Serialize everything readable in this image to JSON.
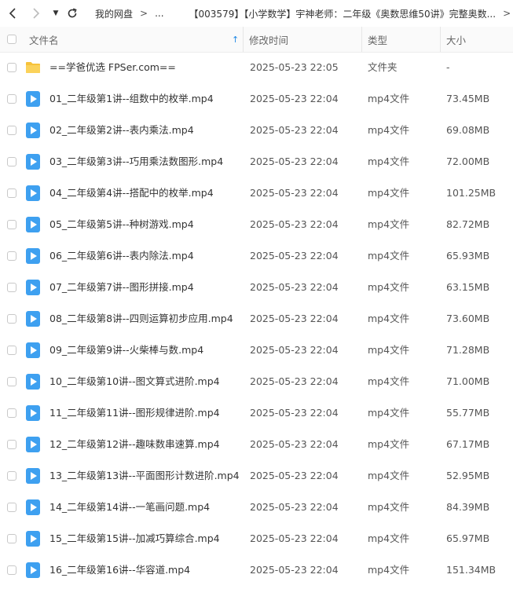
{
  "breadcrumb": {
    "home": "我的网盘",
    "ellipsis": "...",
    "current": "【003579】【小学数学】宇神老师：二年级《奥数思维50讲》完整奥数...",
    "separator": ">"
  },
  "columns": {
    "name": "文件名",
    "modified": "修改时间",
    "type": "类型",
    "size": "大小"
  },
  "icons": {
    "folder": "folder-icon",
    "video": "video-file-icon"
  },
  "colors": {
    "accent": "#1e88e5",
    "folder": "#f7c23a",
    "video": "#3ea0f0"
  },
  "files": [
    {
      "name": "==学爸优选 FPSer.com==",
      "modified": "2025-05-23 22:05",
      "type": "文件夹",
      "size": "-",
      "kind": "folder"
    },
    {
      "name": "01_二年级第1讲--组数中的枚举.mp4",
      "modified": "2025-05-23 22:04",
      "type": "mp4文件",
      "size": "73.45MB",
      "kind": "video"
    },
    {
      "name": "02_二年级第2讲--表内乘法.mp4",
      "modified": "2025-05-23 22:04",
      "type": "mp4文件",
      "size": "69.08MB",
      "kind": "video"
    },
    {
      "name": "03_二年级第3讲--巧用乘法数图形.mp4",
      "modified": "2025-05-23 22:04",
      "type": "mp4文件",
      "size": "72.00MB",
      "kind": "video"
    },
    {
      "name": "04_二年级第4讲--搭配中的枚举.mp4",
      "modified": "2025-05-23 22:04",
      "type": "mp4文件",
      "size": "101.25MB",
      "kind": "video"
    },
    {
      "name": "05_二年级第5讲--种树游戏.mp4",
      "modified": "2025-05-23 22:04",
      "type": "mp4文件",
      "size": "82.72MB",
      "kind": "video"
    },
    {
      "name": "06_二年级第6讲--表内除法.mp4",
      "modified": "2025-05-23 22:04",
      "type": "mp4文件",
      "size": "65.93MB",
      "kind": "video"
    },
    {
      "name": "07_二年级第7讲--图形拼接.mp4",
      "modified": "2025-05-23 22:04",
      "type": "mp4文件",
      "size": "63.15MB",
      "kind": "video"
    },
    {
      "name": "08_二年级第8讲--四则运算初步应用.mp4",
      "modified": "2025-05-23 22:04",
      "type": "mp4文件",
      "size": "73.60MB",
      "kind": "video"
    },
    {
      "name": "09_二年级第9讲--火柴棒与数.mp4",
      "modified": "2025-05-23 22:04",
      "type": "mp4文件",
      "size": "71.28MB",
      "kind": "video"
    },
    {
      "name": "10_二年级第10讲--图文算式进阶.mp4",
      "modified": "2025-05-23 22:04",
      "type": "mp4文件",
      "size": "71.00MB",
      "kind": "video"
    },
    {
      "name": "11_二年级第11讲--图形规律进阶.mp4",
      "modified": "2025-05-23 22:04",
      "type": "mp4文件",
      "size": "55.77MB",
      "kind": "video"
    },
    {
      "name": "12_二年级第12讲--趣味数串速算.mp4",
      "modified": "2025-05-23 22:04",
      "type": "mp4文件",
      "size": "67.17MB",
      "kind": "video"
    },
    {
      "name": "13_二年级第13讲--平面图形计数进阶.mp4",
      "modified": "2025-05-23 22:04",
      "type": "mp4文件",
      "size": "52.95MB",
      "kind": "video"
    },
    {
      "name": "14_二年级第14讲--一笔画问题.mp4",
      "modified": "2025-05-23 22:04",
      "type": "mp4文件",
      "size": "84.39MB",
      "kind": "video"
    },
    {
      "name": "15_二年级第15讲--加减巧算综合.mp4",
      "modified": "2025-05-23 22:04",
      "type": "mp4文件",
      "size": "65.97MB",
      "kind": "video"
    },
    {
      "name": "16_二年级第16讲--华容道.mp4",
      "modified": "2025-05-23 22:04",
      "type": "mp4文件",
      "size": "151.34MB",
      "kind": "video"
    }
  ]
}
